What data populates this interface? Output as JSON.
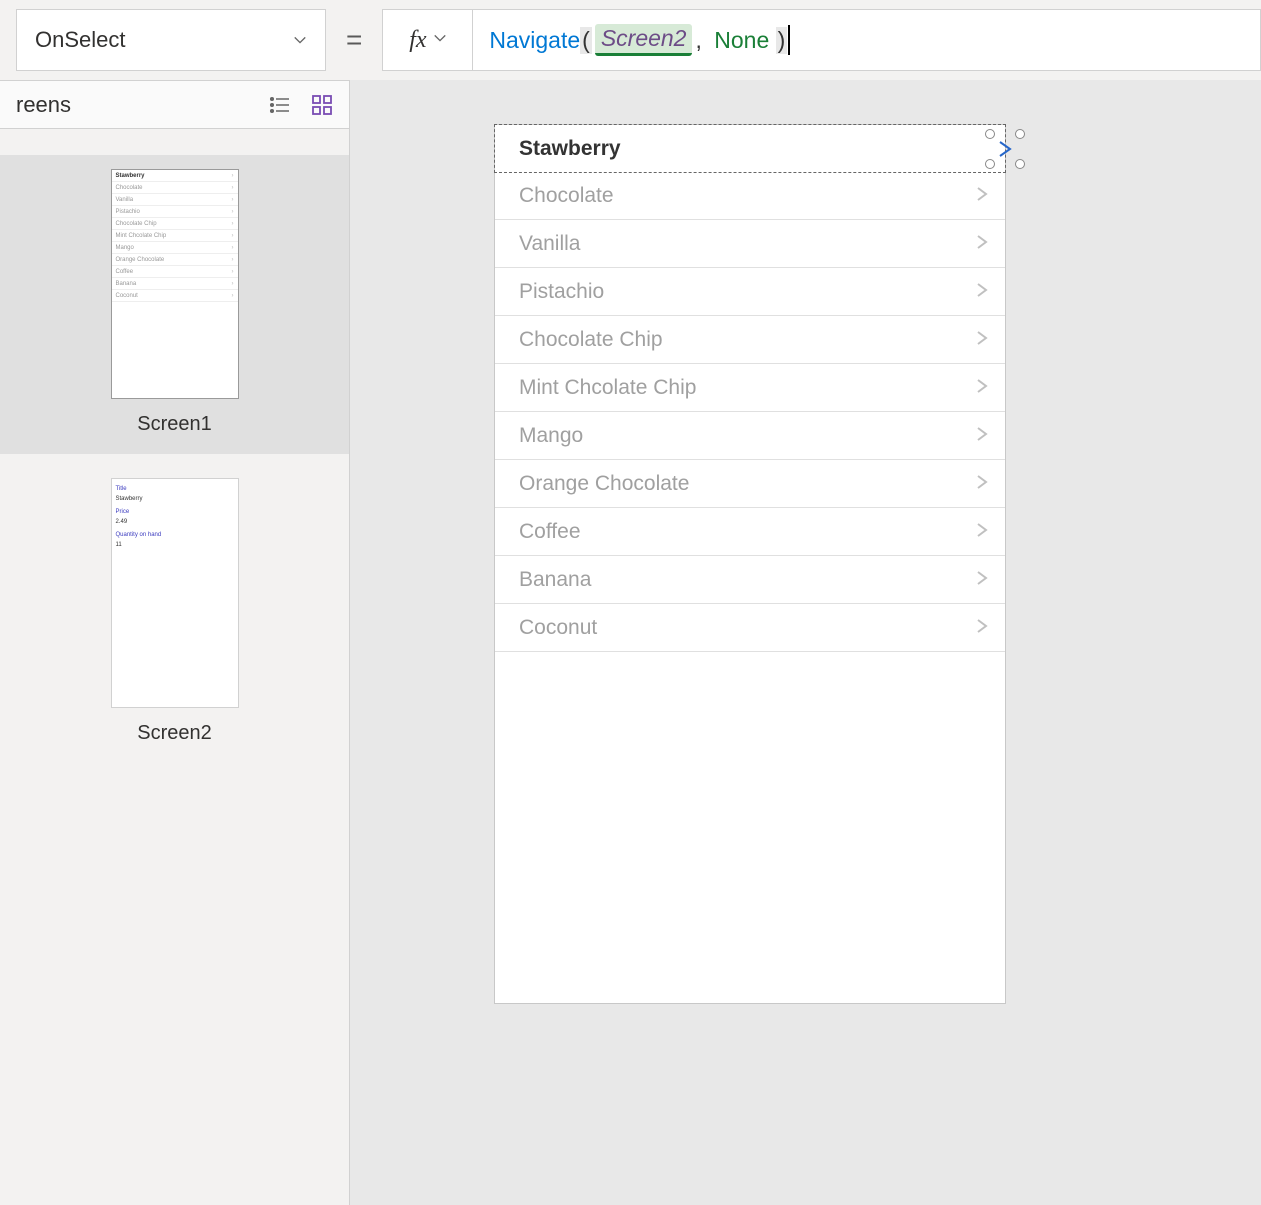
{
  "formula_bar": {
    "property": "OnSelect",
    "equals": "=",
    "fx": "fx",
    "formula": {
      "func": "Navigate",
      "open": "(",
      "arg1": "Screen2",
      "comma": ",",
      "arg2": "None",
      "close": ")"
    }
  },
  "left_panel": {
    "title": "reens",
    "screens": [
      {
        "label": "Screen1",
        "selected": true
      },
      {
        "label": "Screen2",
        "selected": false
      }
    ],
    "thumb1_rows": [
      "Stawberry",
      "Chocolate",
      "Vanilla",
      "Pistachio",
      "Chocolate Chip",
      "Mint Chcolate Chip",
      "Mango",
      "Orange Chocolate",
      "Coffee",
      "Banana",
      "Coconut"
    ],
    "thumb2_fields": {
      "label1": "Title",
      "value1": "Stawberry",
      "label2": "Price",
      "value2": "2.49",
      "label3": "Quantity on hand",
      "value3": "11"
    }
  },
  "canvas": {
    "rows": [
      "Stawberry",
      "Chocolate",
      "Vanilla",
      "Pistachio",
      "Chocolate Chip",
      "Mint Chcolate Chip",
      "Mango",
      "Orange Chocolate",
      "Coffee",
      "Banana",
      "Coconut"
    ],
    "selected_index": 0
  }
}
